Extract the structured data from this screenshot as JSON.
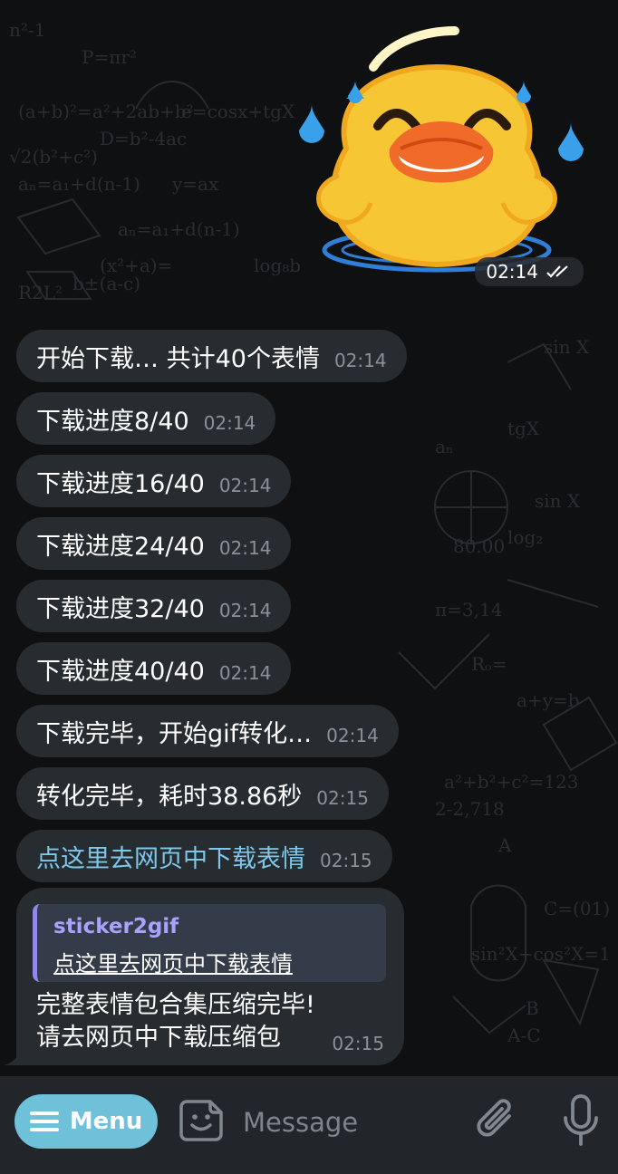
{
  "chat": {
    "sticker": {
      "time": "02:14",
      "status": "read-double-check"
    },
    "messages": [
      {
        "text": "开始下载… 共计40个表情",
        "time": "02:14",
        "link": false
      },
      {
        "text": "下载进度8/40",
        "time": "02:14",
        "link": false
      },
      {
        "text": "下载进度16/40",
        "time": "02:14",
        "link": false
      },
      {
        "text": "下载进度24/40",
        "time": "02:14",
        "link": false
      },
      {
        "text": "下载进度32/40",
        "time": "02:14",
        "link": false
      },
      {
        "text": "下载进度40/40",
        "time": "02:14",
        "link": false
      },
      {
        "text": "下载完毕，开始gif转化…",
        "time": "02:14",
        "link": false
      },
      {
        "text": "转化完毕，耗时38.86秒",
        "time": "02:15",
        "link": false
      },
      {
        "text": "点这里去网页中下载表情",
        "time": "02:15",
        "link": true
      }
    ],
    "final_message": {
      "quote_title": "sticker2gif",
      "quote_link": "点这里去网页中下载表情",
      "line1": "完整表情包合集压缩完毕!",
      "line2": "请去网页中下载压缩包",
      "time": "02:15"
    }
  },
  "input_bar": {
    "menu_label": "Menu",
    "placeholder": "Message",
    "icons": [
      "menu-icon",
      "sticker-icon",
      "paperclip-icon",
      "microphone-icon"
    ]
  },
  "colors": {
    "bubble": "#272c31",
    "link": "#7ec8ea",
    "menu_button": "#6ec1d8",
    "quote_accent": "#8f89e8"
  }
}
